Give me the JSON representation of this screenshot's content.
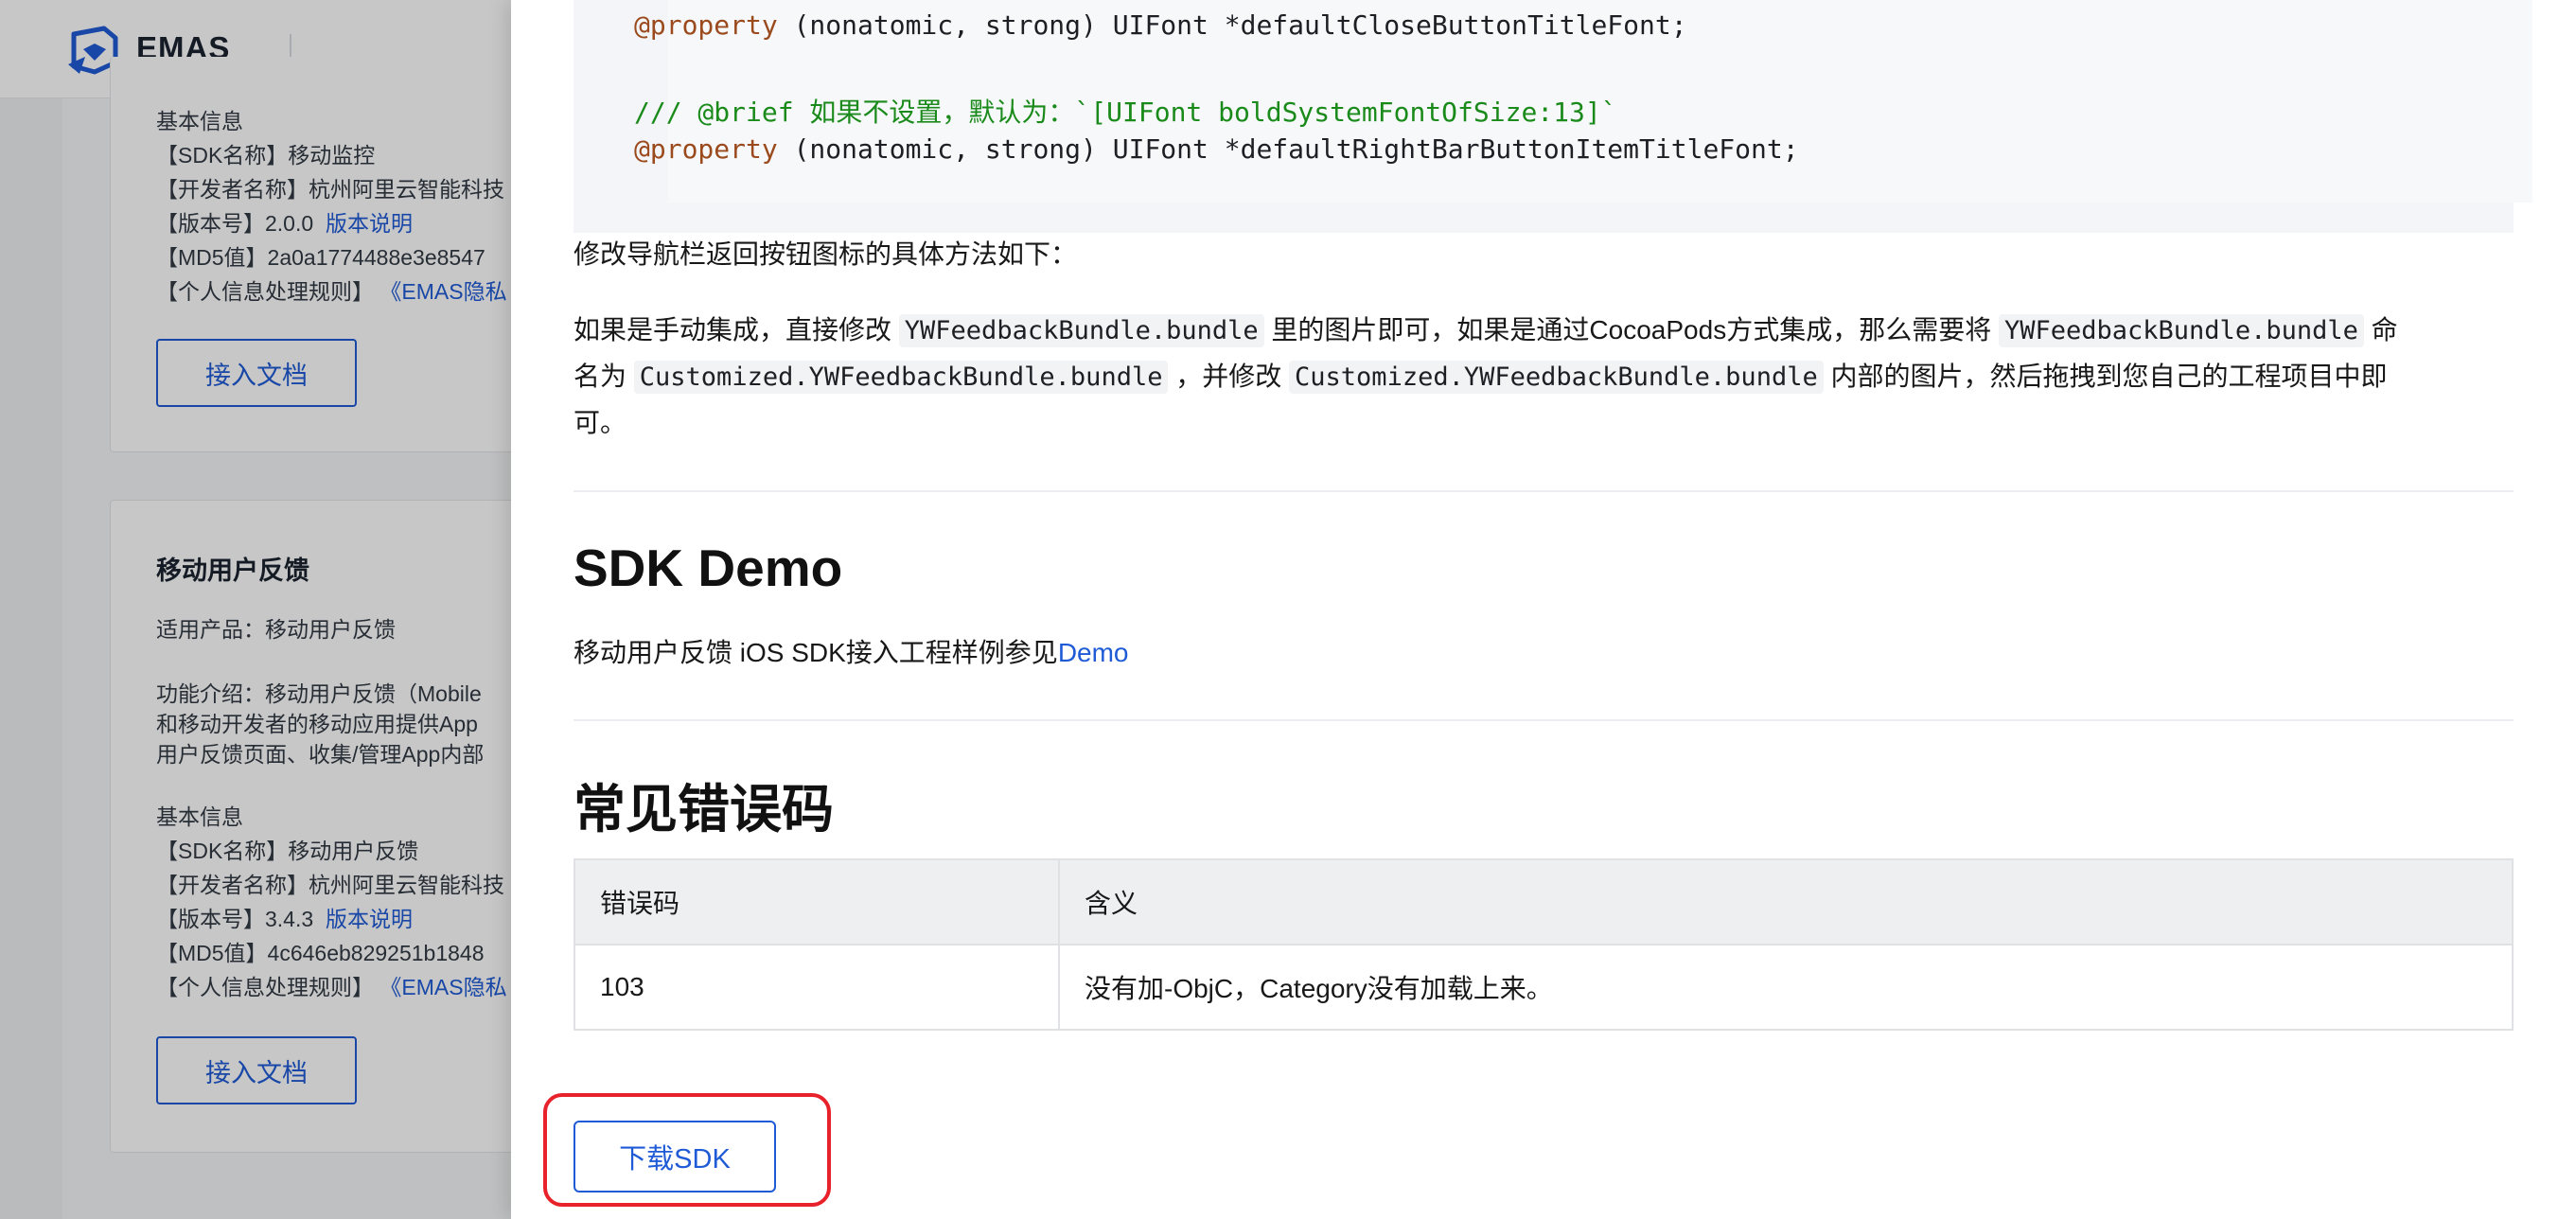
{
  "header": {
    "logo_text": "EMAS"
  },
  "card1": {
    "lines": [
      {
        "label": "基本信息",
        "value": "",
        "link": ""
      },
      {
        "label": "【SDK名称】移动监控",
        "value": "",
        "link": ""
      },
      {
        "label": "【开发者名称】杭州阿里云智能科技",
        "value": "",
        "link": ""
      },
      {
        "label": "【版本号】2.0.0",
        "value": "",
        "link": "版本说明"
      },
      {
        "label": "【MD5值】2a0a1774488e3e8547",
        "value": "",
        "link": ""
      },
      {
        "label": "【个人信息处理规则】",
        "value": "",
        "link": "《EMAS隐私"
      }
    ],
    "button": "接入文档"
  },
  "card2": {
    "title": "移动用户反馈",
    "applicable": "适用产品：移动用户反馈",
    "intro": [
      "功能介绍：移动用户反馈（Mobile",
      "和移动开发者的移动应用提供App",
      "用户反馈页面、收集/管理App内部"
    ],
    "lines": [
      {
        "label": "基本信息",
        "link": ""
      },
      {
        "label": "【SDK名称】移动用户反馈",
        "link": ""
      },
      {
        "label": "【开发者名称】杭州阿里云智能科技",
        "link": ""
      },
      {
        "label": "【版本号】3.4.3",
        "link": "版本说明"
      },
      {
        "label": "【MD5值】4c646eb829251b1848",
        "link": ""
      },
      {
        "label": "【个人信息处理规则】",
        "link": "《EMAS隐私"
      }
    ],
    "button": "接入文档"
  },
  "doc": {
    "code": {
      "line1_kw": "@property",
      "line1_rest": " (nonatomic, strong) UIFont *defaultCloseButtonTitleFont;",
      "comment": "/// @brief 如果不设置，默认为：`[UIFont boldSystemFontOfSize:13]`",
      "line3_kw": "@property",
      "line3_rest": " (nonatomic, strong) UIFont *defaultRightBarButtonItemTitleFont;"
    },
    "para1": "修改导航栏返回按钮图标的具体方法如下：",
    "para2": {
      "t1": "如果是手动集成，直接修改 ",
      "c1": "YWFeedbackBundle.bundle",
      "t2": " 里的图片即可，如果是通过CocoaPods方式集成，那么需要将 ",
      "c2": "YWFeedbackBundle.bundle",
      "t3": " 命",
      "t4": "名为 ",
      "c3": "Customized.YWFeedbackBundle.bundle",
      "t5": " ，并修改 ",
      "c4": "Customized.YWFeedbackBundle.bundle",
      "t6": " 内部的图片，然后拖拽到您自己的工程项目中即",
      "t7": "可。"
    },
    "demo_heading": "SDK Demo",
    "demo_text": "移动用户反馈 iOS SDK接入工程样例参见",
    "demo_link": "Demo",
    "errors_heading": "常见错误码",
    "table": {
      "headers": [
        "错误码",
        "含义"
      ],
      "rows": [
        [
          "103",
          "没有加-ObjC，Category没有加载上来。"
        ]
      ]
    },
    "download_button": "下载SDK"
  },
  "colors": {
    "accent": "#1f5bd6",
    "highlight": "#e8222a",
    "comment": "#1a8a1a",
    "keyword": "#9a4a1c"
  }
}
